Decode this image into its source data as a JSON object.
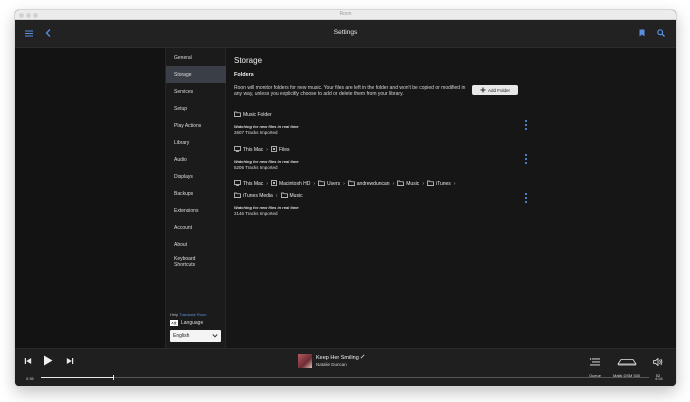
{
  "window": {
    "title": "Roon"
  },
  "header": {
    "title": "Settings"
  },
  "sidebar": {
    "items": [
      {
        "label": "General"
      },
      {
        "label": "Storage",
        "active": true
      },
      {
        "label": "Services"
      },
      {
        "label": "Setup"
      },
      {
        "label": "Play Actions"
      },
      {
        "label": "Library"
      },
      {
        "label": "Audio"
      },
      {
        "label": "Displays"
      },
      {
        "label": "Backups"
      },
      {
        "label": "Extensions"
      },
      {
        "label": "Account"
      },
      {
        "label": "About"
      },
      {
        "label": "Keyboard Shortcuts"
      }
    ],
    "help_label": "Help",
    "translate_link": "Translate Roon",
    "language_label": "Language",
    "language_value": "English"
  },
  "storage": {
    "title": "Storage",
    "folders_heading": "Folders",
    "description": "Roon will monitor folders for new music. Your files are left in the folder and won't be copied or modified in any way, unless you explicitly choose to add or delete them from your library.",
    "add_folder_label": "Add Folder",
    "folders": [
      {
        "path": [
          "Music Folder"
        ],
        "status": "Watching for new files in real time",
        "tracks": "2607 Tracks Imported"
      },
      {
        "path": [
          "This Mac",
          "Files"
        ],
        "status": "Watching for new files in real time",
        "tracks": "5206 Tracks Imported"
      },
      {
        "path": [
          "This Mac",
          "Macintosh HD",
          "Users",
          "andrewduncan",
          "Music",
          "iTunes",
          "iTunes Media",
          "Music"
        ],
        "status": "Watching for new files in real time",
        "tracks": "2146 Tracks Imported"
      }
    ]
  },
  "player": {
    "track_title": "Keep Her Smiling",
    "artist": "Natalie Duncan",
    "elapsed": "0:35",
    "duration": "4:54",
    "progress": 0.119,
    "queue_label": "Queue",
    "zone_label": "Majik DSM 530",
    "volume": "52"
  },
  "colors": {
    "accent": "#5a8ee0",
    "active_item": "#3a3e47",
    "background": "#161616"
  }
}
